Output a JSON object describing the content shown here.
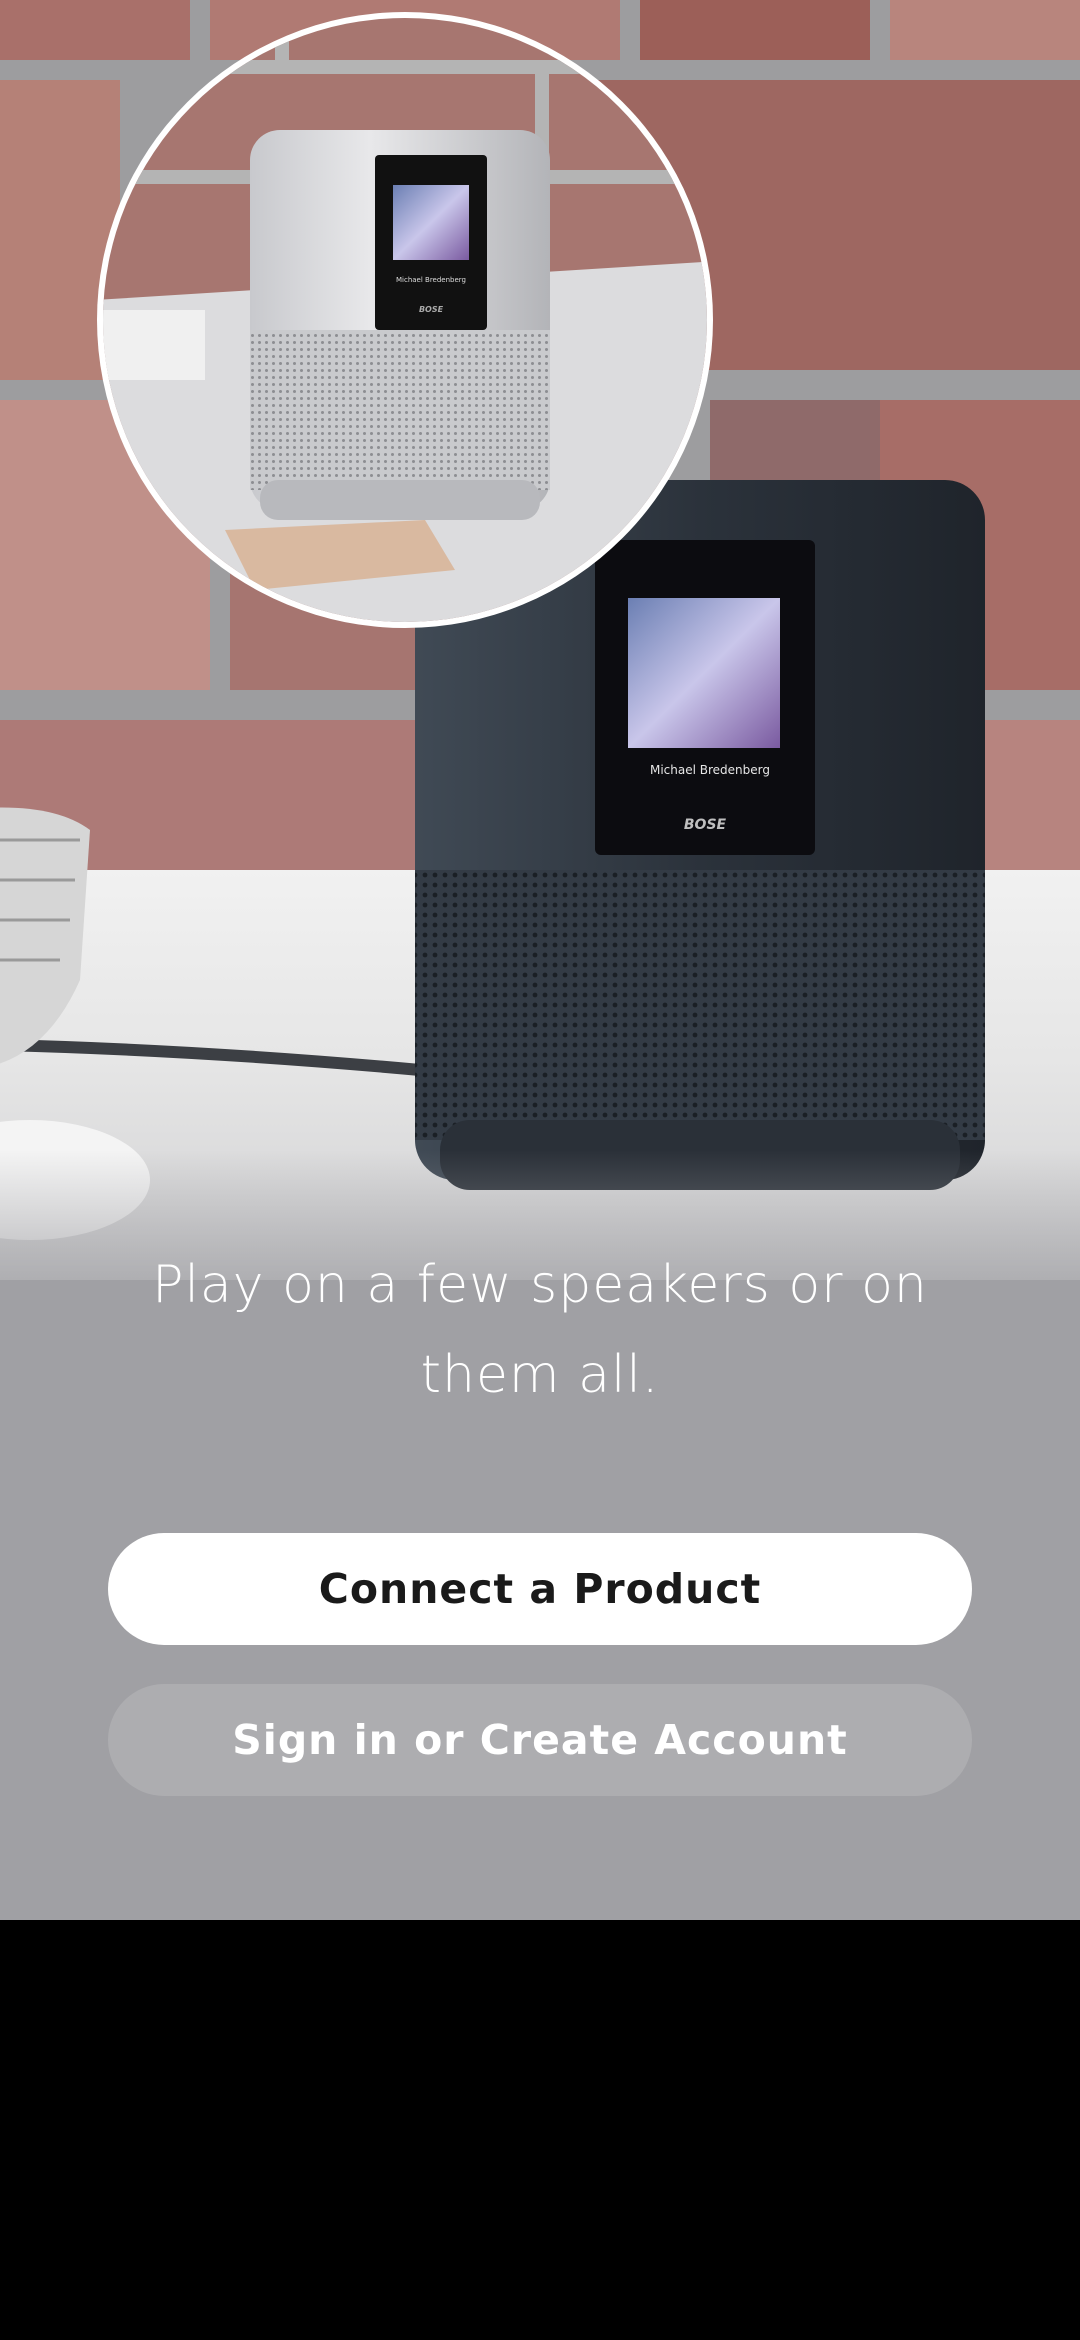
{
  "hero": {
    "speaker_screen_artist": "Michael Bredenberg",
    "speaker_screen_brand": "BOSE",
    "inset_screen_artist": "Michael Bredenberg",
    "inset_screen_brand": "BOSE"
  },
  "onboarding": {
    "tagline": "Play on a few speakers or on them all."
  },
  "actions": {
    "connect_label": "Connect a Product",
    "signin_label": "Sign in or Create Account"
  },
  "colors": {
    "panel": "#a0a0a4",
    "primary_button_bg": "#ffffff",
    "primary_button_text": "#1a1a1a",
    "secondary_button_text": "#ffffff"
  }
}
